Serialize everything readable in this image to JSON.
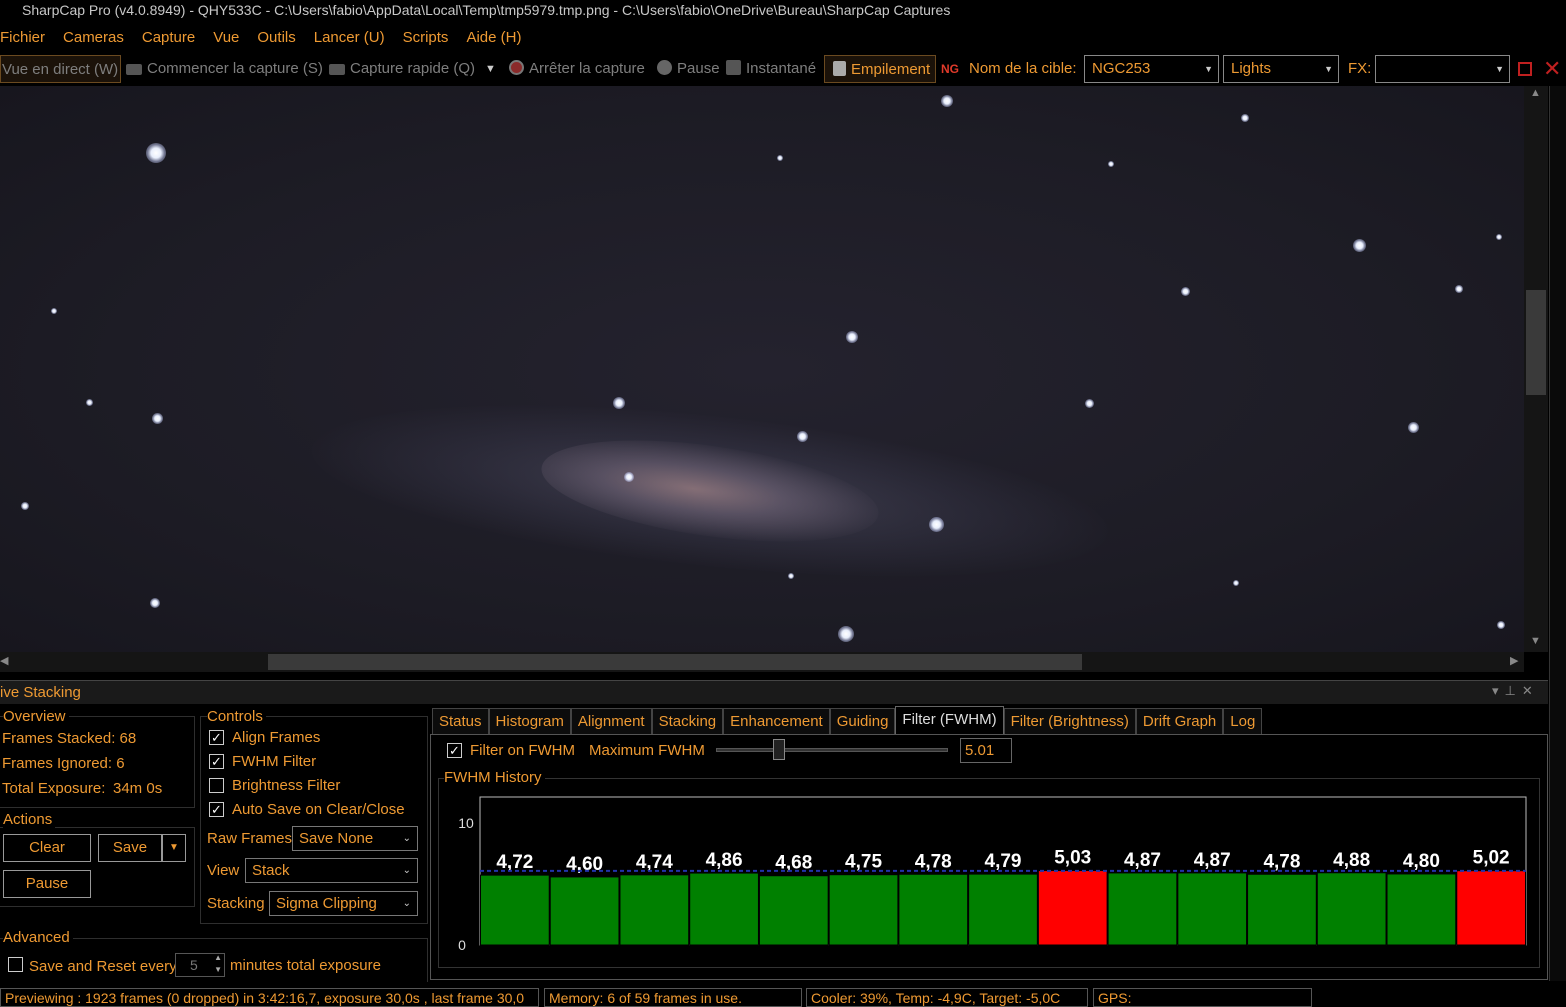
{
  "window": {
    "title": "SharpCap Pro (v4.0.8949) - QHY533C - C:\\Users\\fabio\\AppData\\Local\\Temp\\tmp5979.tmp.png - C:\\Users\\fabio\\OneDrive\\Bureau\\SharpCap Captures"
  },
  "menu": [
    "Fichier",
    "Cameras",
    "Capture",
    "Vue",
    "Outils",
    "Lancer (U)",
    "Scripts",
    "Aide (H)"
  ],
  "toolbar": {
    "live_view": "Vue en direct (W)",
    "start_capture": "Commencer la capture (S)",
    "quick_capture": "Capture rapide (Q)",
    "stop_capture": "Arrêter la capture",
    "pause": "Pause",
    "snapshot": "Instantané",
    "stacking": "Empilement",
    "target_label": "Nom de la cible:",
    "target_value": "NGC253",
    "frame_type": "Lights",
    "fx_label": "FX:",
    "fx_value": ""
  },
  "live_stacking": {
    "panel_title": "ive Stacking",
    "overview": {
      "title": "Overview",
      "frames_stacked": "Frames Stacked: 68",
      "frames_ignored": "Frames Ignored: 6",
      "total_exposure_label": "Total Exposure:",
      "total_exposure_value": "34m 0s"
    },
    "actions": {
      "title": "Actions",
      "clear": "Clear",
      "save": "Save",
      "pause": "Pause"
    },
    "controls": {
      "title": "Controls",
      "align_frames": {
        "label": "Align Frames",
        "checked": true
      },
      "fwhm_filter": {
        "label": "FWHM Filter",
        "checked": true
      },
      "brightness_filter": {
        "label": "Brightness Filter",
        "checked": false
      },
      "auto_save": {
        "label": "Auto Save on Clear/Close",
        "checked": true
      },
      "raw_frames_label": "Raw Frames",
      "raw_frames_value": "Save None",
      "view_label": "View",
      "view_value": "Stack",
      "stacking_label": "Stacking",
      "stacking_value": "Sigma Clipping"
    },
    "advanced": {
      "title": "Advanced",
      "save_reset_label": "Save and Reset every",
      "save_reset_checked": false,
      "minutes_value": "5",
      "minutes_suffix": "minutes total exposure"
    },
    "tabs": [
      "Status",
      "Histogram",
      "Alignment",
      "Stacking",
      "Enhancement",
      "Guiding",
      "Filter (FWHM)",
      "Filter (Brightness)",
      "Drift Graph",
      "Log"
    ],
    "active_tab": "Filter (FWHM)",
    "filter_fwhm": {
      "filter_on_label": "Filter on FWHM",
      "filter_on_checked": true,
      "max_label": "Maximum FWHM",
      "max_value": "5.01",
      "slider_fraction": 0.27,
      "history_title": "FWHM History"
    }
  },
  "chart_data": {
    "type": "bar",
    "title": "FWHM History",
    "ylim": [
      0,
      10
    ],
    "yticks": [
      "10",
      "0"
    ],
    "threshold": 5.01,
    "values": [
      4.72,
      4.6,
      4.74,
      4.86,
      4.68,
      4.75,
      4.78,
      4.79,
      5.03,
      4.87,
      4.87,
      4.78,
      4.88,
      4.8,
      5.02
    ],
    "labels": [
      "4,72",
      "4,60",
      "4,74",
      "4,86",
      "4,68",
      "4,75",
      "4,78",
      "4,79",
      "5,03",
      "4,87",
      "4,87",
      "4,78",
      "4,88",
      "4,80",
      "5,02"
    ],
    "colors": {
      "accepted": "#008000",
      "rejected": "#ff0000",
      "threshold_line": "#2233aa"
    }
  },
  "statusbar": {
    "previewing": "Previewing : 1923 frames (0 dropped) in 3:42:16,7, exposure 30,0s , last frame 30,0",
    "memory": "Memory: 6 of 59 frames in use.",
    "cooler": "Cooler: 39%, Temp: -4,9C, Target: -5,0C",
    "gps": "GPS:"
  },
  "colors": {
    "accent": "#ee9a33",
    "background": "#000000"
  }
}
